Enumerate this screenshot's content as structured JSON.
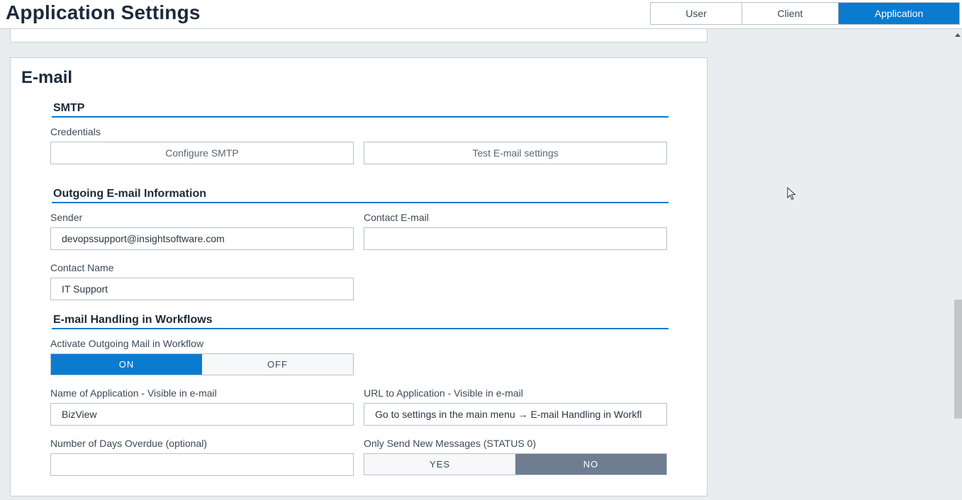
{
  "header": {
    "title": "Application Settings",
    "tabs": [
      {
        "label": "User",
        "active": false
      },
      {
        "label": "Client",
        "active": false
      },
      {
        "label": "Application",
        "active": true
      }
    ]
  },
  "email_panel": {
    "title": "E-mail",
    "smtp": {
      "heading": "SMTP",
      "credentials_label": "Credentials",
      "configure_button": "Configure SMTP",
      "test_button": "Test E-mail settings"
    },
    "outgoing": {
      "heading": "Outgoing E-mail Information",
      "sender_label": "Sender",
      "sender_value": "devopssupport@insightsoftware.com",
      "contact_email_label": "Contact E-mail",
      "contact_email_value": "",
      "contact_name_label": "Contact Name",
      "contact_name_value": "IT Support"
    },
    "workflows": {
      "heading": "E-mail Handling in Workflows",
      "activate_label": "Activate Outgoing Mail in Workflow",
      "activate_on": "ON",
      "activate_off": "OFF",
      "activate_selected": "ON",
      "app_name_label": "Name of Application - Visible in e-mail",
      "app_name_value": "BizView",
      "url_label": "URL to Application - Visible in e-mail",
      "url_value": "Go to settings in the main menu → E-mail Handling in Workfl",
      "days_overdue_label": "Number of Days Overdue (optional)",
      "days_overdue_value": "",
      "only_new_label": "Only Send New Messages (STATUS 0)",
      "only_new_yes": "YES",
      "only_new_no": "NO",
      "only_new_selected": "NO"
    }
  },
  "colors": {
    "accent": "#0b7bd0",
    "toggle_gray": "#6e7d90",
    "background": "#e9edf0"
  }
}
